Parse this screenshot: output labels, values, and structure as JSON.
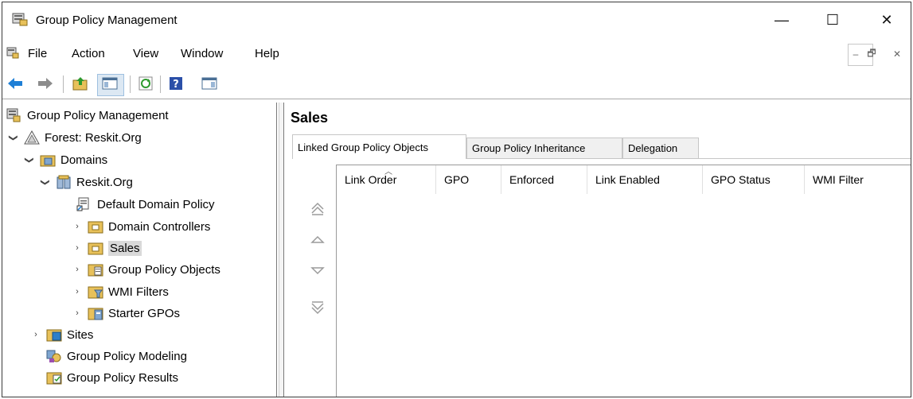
{
  "window": {
    "title": "Group Policy Management",
    "controls": {
      "minimize": "—",
      "maximize": "☐",
      "close": "✕"
    }
  },
  "menu": {
    "items": [
      "File",
      "Action",
      "View",
      "Window",
      "Help"
    ],
    "mdi_controls": {
      "minimize": "–",
      "restore": "🗗",
      "close": "✕"
    }
  },
  "toolbar": {
    "buttons": [
      "back-icon",
      "forward-icon",
      "up-folder-icon",
      "show-hide-tree-icon",
      "refresh-icon",
      "help-icon",
      "show-action-pane-icon"
    ]
  },
  "tree": {
    "root": "Group Policy Management",
    "forest": "Forest: Reskit.Org",
    "domains": "Domains",
    "domain": "Reskit.Org",
    "default_policy": "Default Domain Policy",
    "domain_controllers": "Domain Controllers",
    "sales": "Sales",
    "gpo_objects": "Group Policy Objects",
    "wmi_filters": "WMI Filters",
    "starter_gpos": "Starter GPOs",
    "sites": "Sites",
    "modeling": "Group Policy Modeling",
    "results": "Group Policy Results"
  },
  "details": {
    "title": "Sales",
    "tabs": [
      "Linked Group Policy Objects",
      "Group Policy Inheritance",
      "Delegation"
    ],
    "active_tab": "Linked Group Policy Objects",
    "columns": [
      "Link Order",
      "GPO",
      "Enforced",
      "Link Enabled",
      "GPO Status",
      "WMI Filter"
    ],
    "sorted_column": "Link Order",
    "order_buttons": [
      "move-top-icon",
      "move-up-icon",
      "move-down-icon",
      "move-bottom-icon"
    ]
  },
  "colors": {
    "accent": "#1e7fd6",
    "folder": "#e8c15a",
    "selected": "#d9d9d9"
  }
}
